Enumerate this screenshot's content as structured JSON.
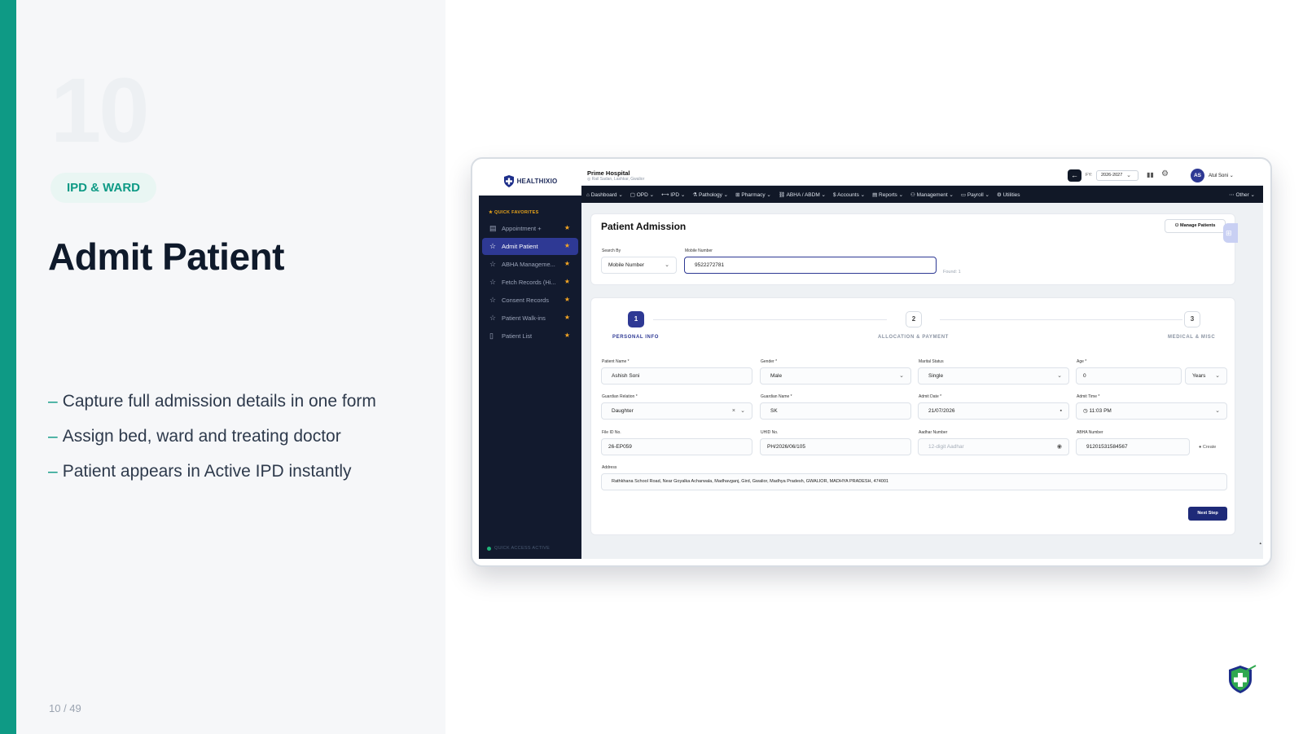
{
  "slide": {
    "number": "10",
    "tag": "IPD & WARD",
    "title": "Admit Patient",
    "bullets": [
      "Capture full admission details in one form",
      "Assign bed, ward and treating doctor",
      "Patient appears in Active IPD instantly"
    ],
    "bullet_dash": "–",
    "page": "10 / 49"
  },
  "colors": {
    "accent": "#0e9a85",
    "sidebar": "#121a2e",
    "primary": "#2e3994",
    "star": "#f5a623",
    "navbar": "#111827"
  },
  "app": {
    "logo_text": "HEALTHIXIO",
    "sidebar": {
      "section": "★ QUICK FAVORITES",
      "items": [
        {
          "label": "Appointment +",
          "icon": "calendar-icon"
        },
        {
          "label": "Admit Patient",
          "icon": "star-outline-icon",
          "active": true
        },
        {
          "label": "ABHA Manageme...",
          "icon": "star-outline-icon"
        },
        {
          "label": "Fetch Records (Hi...",
          "icon": "star-outline-icon"
        },
        {
          "label": "Consent Records",
          "icon": "star-outline-icon"
        },
        {
          "label": "Patient Walk-ins",
          "icon": "star-outline-icon"
        },
        {
          "label": "Patient List",
          "icon": "document-icon"
        }
      ],
      "footer": "QUICK ACCESS ACTIVE"
    },
    "topbar": {
      "hospital": "Prime Hospital",
      "location": "◎ Rail Sadan, Lashkar, Gwalior",
      "fy_label": "FY:",
      "fy_value": "2026-2027",
      "user_initials": "AS",
      "user_name": "Atul Soni"
    },
    "nav": [
      "⌂ Dashboard ⌄",
      "▢ OPD ⌄",
      "⟷ IPD ⌄",
      "⚗ Pathology ⌄",
      "⊞ Pharmacy ⌄",
      "⛓ ABHA / ABDM ⌄",
      "$ Accounts ⌄",
      "▤ Reports ⌄",
      "⚇ Management ⌄",
      "▭ Payroll ⌄",
      "⚙ Utilities"
    ],
    "nav_other": "⋯ Other ⌄",
    "admission": {
      "title": "Patient Admission",
      "manage_button": "Manage Patients",
      "search_by_label": "Search By",
      "search_by_value": "Mobile Number",
      "mobile_label": "Mobile Number",
      "mobile_value": "9522272781",
      "found": "Found: 1"
    },
    "steps": [
      {
        "num": "1",
        "label": "PERSONAL INFO",
        "state": "active"
      },
      {
        "num": "2",
        "label": "ALLOCATION & PAYMENT",
        "state": "pending"
      },
      {
        "num": "3",
        "label": "MEDICAL & MISC",
        "state": "pending"
      }
    ],
    "form": {
      "patient_name": {
        "label": "Patient Name *",
        "value": "Ashish Soni"
      },
      "gender": {
        "label": "Gender *",
        "value": "Male"
      },
      "marital": {
        "label": "Marital Status",
        "value": "Single"
      },
      "age": {
        "label": "Age *",
        "value": "0",
        "unit": "Years"
      },
      "guardian_relation": {
        "label": "Guardian Relation *",
        "value": "Daughter"
      },
      "guardian_name": {
        "label": "Guardian Name *",
        "value": "SK"
      },
      "admit_date": {
        "label": "Admit Date *",
        "value": "21/07/2026"
      },
      "admit_time": {
        "label": "Admit Time *",
        "value": "11:03 PM"
      },
      "file_id": {
        "label": "File ID No.",
        "value": "26-EP059"
      },
      "uhid": {
        "label": "UHID No.",
        "value": "PH/2026/06/105"
      },
      "aadhar": {
        "label": "Aadhar Number",
        "placeholder": "12-digit Aadhar"
      },
      "abha": {
        "label": "ABHA Number",
        "value": "91201531584567",
        "create": "Create"
      },
      "address": {
        "label": "Address",
        "value": "Rathkhana School Road, Near Goyalka Acharwala, Madhavganj, Gird, Gwalior, Madhya Pradesh, GWALIOR, MADHYA PRADESH, 474001"
      },
      "next_button": "Next Step"
    }
  }
}
